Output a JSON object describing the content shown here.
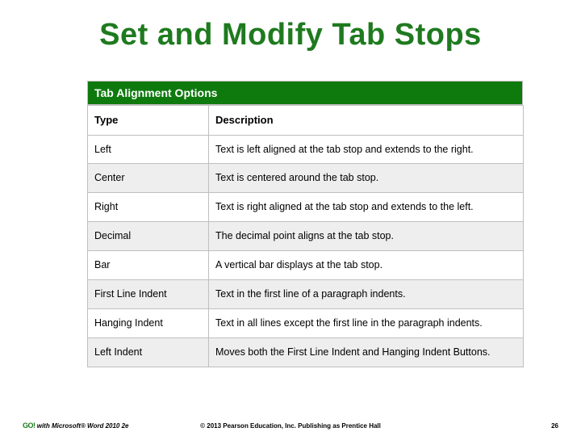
{
  "title": "Set and Modify Tab Stops",
  "caption": "Tab Alignment Options",
  "headers": {
    "type": "Type",
    "desc": "Description"
  },
  "rows": [
    {
      "type": "Left",
      "desc": "Text is left aligned at the tab stop and extends to the right."
    },
    {
      "type": "Center",
      "desc": "Text is centered around the tab stop."
    },
    {
      "type": "Right",
      "desc": "Text is right aligned at the tab stop and extends to the left."
    },
    {
      "type": "Decimal",
      "desc": "The decimal point aligns at the tab stop."
    },
    {
      "type": "Bar",
      "desc": "A vertical bar displays at the tab stop."
    },
    {
      "type": "First Line Indent",
      "desc": "Text in the first line of a paragraph indents."
    },
    {
      "type": "Hanging Indent",
      "desc": "Text in all lines except the first line in the paragraph indents."
    },
    {
      "type": "Left Indent",
      "desc": "Moves both the First Line Indent and Hanging Indent Buttons."
    }
  ],
  "footer": {
    "logo": "GO!",
    "left": " with Microsoft® Word  2010 2e",
    "center": "© 2013 Pearson Education, Inc. Publishing as Prentice Hall",
    "right": "26"
  },
  "chart_data": {
    "type": "table",
    "title": "Tab Alignment Options",
    "columns": [
      "Type",
      "Description"
    ],
    "rows": [
      [
        "Left",
        "Text is left aligned at the tab stop and extends to the right."
      ],
      [
        "Center",
        "Text is centered around the tab stop."
      ],
      [
        "Right",
        "Text is right aligned at the tab stop and extends to the left."
      ],
      [
        "Decimal",
        "The decimal point aligns at the tab stop."
      ],
      [
        "Bar",
        "A vertical bar displays at the tab stop."
      ],
      [
        "First Line Indent",
        "Text in the first line of a paragraph indents."
      ],
      [
        "Hanging Indent",
        "Text in all lines except the first line in the paragraph indents."
      ],
      [
        "Left Indent",
        "Moves both the First Line Indent and Hanging Indent Buttons."
      ]
    ]
  }
}
